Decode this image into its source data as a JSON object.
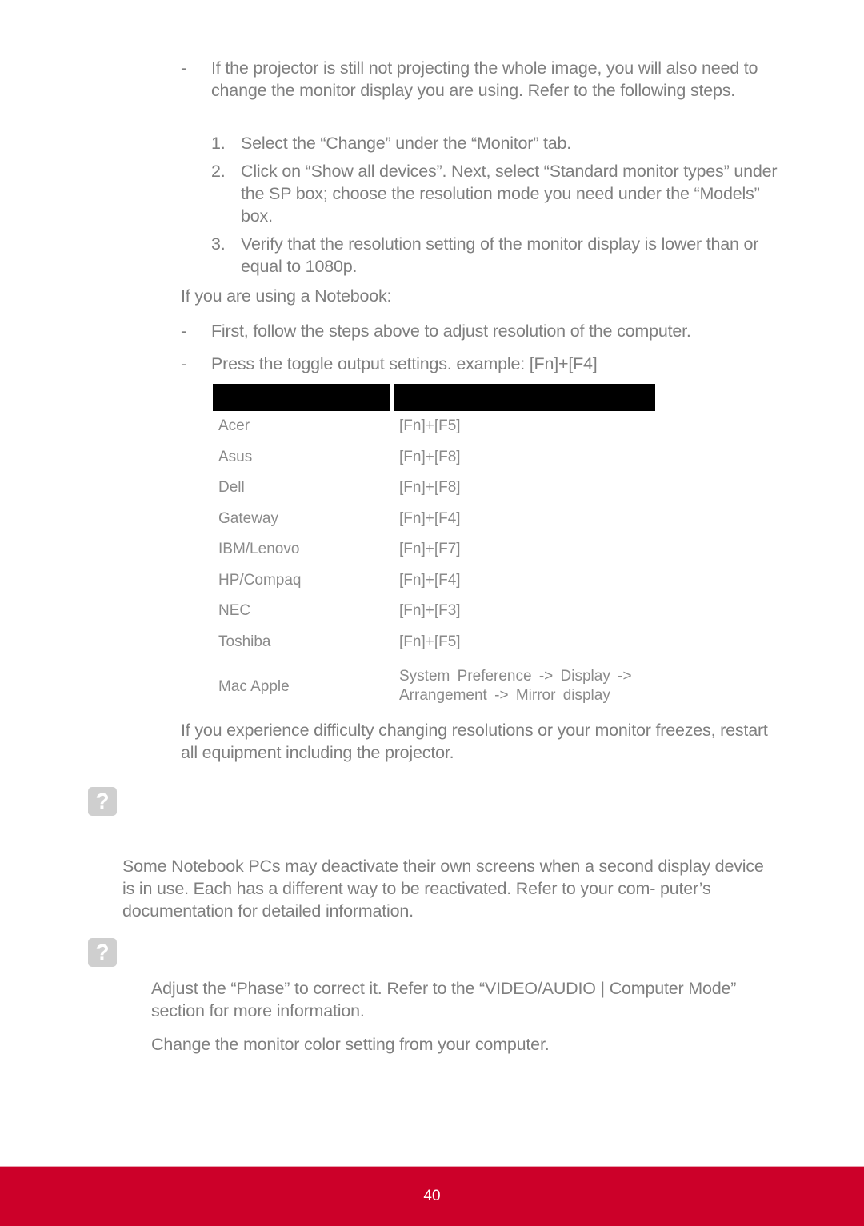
{
  "intro_bullet": {
    "marker": "-",
    "text": "If the projector is still not projecting the whole image, you will also need to change the monitor display you are using. Refer to the following steps."
  },
  "steps": [
    {
      "number": "1.",
      "text": "Select the “Change” under the “Monitor” tab."
    },
    {
      "number": "2.",
      "text": "Click on “Show all devices”. Next, select “Standard monitor types” under the SP box; choose the resolution mode you need under the “Models” box."
    },
    {
      "number": "3.",
      "text": "Verify that the resolution setting of the monitor display is lower than or equal to 1080p."
    }
  ],
  "notebook_heading": "If you are using a Notebook:",
  "notebook_bullets": [
    {
      "marker": "-",
      "text": "First, follow the steps above to adjust resolution of the computer."
    },
    {
      "marker": "-",
      "text": "Press the toggle output settings. example: [Fn]+[F4]"
    }
  ],
  "hotkey_table": {
    "headers": [
      "",
      ""
    ],
    "rows": [
      {
        "brand": "Acer",
        "keys": "[Fn]+[F5]"
      },
      {
        "brand": "Asus",
        "keys": "[Fn]+[F8]"
      },
      {
        "brand": "Dell",
        "keys": "[Fn]+[F8]"
      },
      {
        "brand": "Gateway",
        "keys": "[Fn]+[F4]"
      },
      {
        "brand": "IBM/Lenovo",
        "keys": "[Fn]+[F7]"
      },
      {
        "brand": "HP/Compaq",
        "keys": "[Fn]+[F4]"
      },
      {
        "brand": "NEC",
        "keys": "[Fn]+[F3]"
      },
      {
        "brand": "Toshiba",
        "keys": "[Fn]+[F5]"
      },
      {
        "brand": "Mac Apple",
        "keys": "System Preference -> Display -> Arrangement -> Mirror display"
      }
    ]
  },
  "freeze_note": "If you experience difficulty changing resolutions or your monitor freezes, restart all equipment including the projector.",
  "faq_1": {
    "icon": "?",
    "answer": "Some Notebook PCs may deactivate their own screens when a second display device is in use. Each has a different way to be reactivated. Refer to your com- puter’s documentation for detailed information."
  },
  "faq_2": {
    "icon": "?",
    "answers": [
      "Adjust the “Phase” to correct it. Refer to the “VIDEO/AUDIO | Computer Mode” section for more information.",
      "Change the monitor color setting from your computer."
    ]
  },
  "footer": {
    "page_number": "40",
    "color": "#cc0029"
  }
}
